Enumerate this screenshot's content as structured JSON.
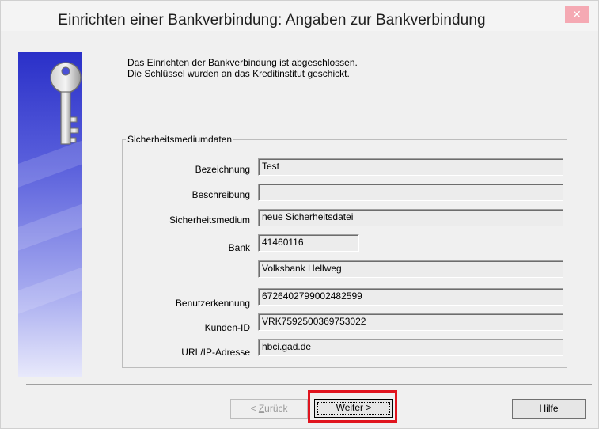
{
  "window": {
    "title": "Einrichten einer Bankverbindung: Angaben zur Bankverbindung",
    "close_glyph": "✕"
  },
  "message": {
    "line1": "Das Einrichten der Bankverbindung ist abgeschlossen.",
    "line2": "Die Schlüssel wurden an das Kreditinstitut geschickt."
  },
  "group": {
    "legend": "Sicherheitsmediumdaten",
    "fields": {
      "bezeichnung": {
        "label": "Bezeichnung",
        "value": "Test"
      },
      "beschreibung": {
        "label": "Beschreibung",
        "value": ""
      },
      "sicherheitsmedium": {
        "label": "Sicherheitsmedium",
        "value": "neue Sicherheitsdatei"
      },
      "bank": {
        "label": "Bank",
        "value": "41460116"
      },
      "bankname": {
        "value": "Volksbank Hellweg"
      },
      "benutzerkennung": {
        "label": "Benutzerkennung",
        "value": "6726402799002482599"
      },
      "kunden_id": {
        "label": "Kunden-ID",
        "value": "VRK7592500369753022"
      },
      "url": {
        "label": "URL/IP-Adresse",
        "value": "hbci.gad.de"
      }
    }
  },
  "buttons": {
    "back_prefix": "< ",
    "back_underlined": "Z",
    "back_rest": "urück",
    "next_underlined": "W",
    "next_rest": "eiter >",
    "help": "Hilfe"
  },
  "colors": {
    "highlight": "#e0141e",
    "banner_top": "#2a30c8",
    "close_button": "#f5a9b3"
  },
  "icons": {
    "banner": "key-icon"
  }
}
